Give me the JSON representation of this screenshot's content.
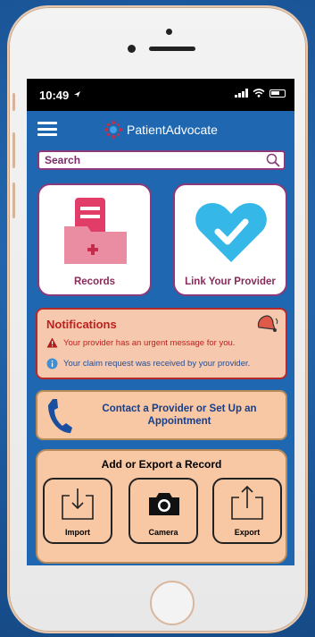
{
  "status": {
    "time": "10:49"
  },
  "app": {
    "brand": "PatientAdvocate"
  },
  "search": {
    "placeholder": "Search"
  },
  "tiles": [
    {
      "label": "Records",
      "icon": "records-folder-icon"
    },
    {
      "label": "Link Your Provider",
      "icon": "heart-check-icon"
    }
  ],
  "notifications": {
    "title": "Notifications",
    "items": [
      {
        "text": "Your provider has an urgent message for you.",
        "icon": "warning-icon"
      },
      {
        "text": "Your claim request was received by your provider.",
        "icon": "info-icon"
      }
    ]
  },
  "contact": {
    "text": "Contact a Provider or Set Up an Appointment"
  },
  "export_section": {
    "title": "Add or Export a Record",
    "buttons": [
      {
        "label": "Import",
        "icon": "import-icon"
      },
      {
        "label": "Camera",
        "icon": "camera-icon"
      },
      {
        "label": "Export",
        "icon": "export-icon"
      }
    ]
  },
  "colors": {
    "screen_bg": "#1f67b1",
    "brand_accent": "#8a3a7a",
    "notification_bg": "#f6c8ad",
    "alert_red": "#c0201f",
    "section_bg": "#f8c7a4"
  }
}
